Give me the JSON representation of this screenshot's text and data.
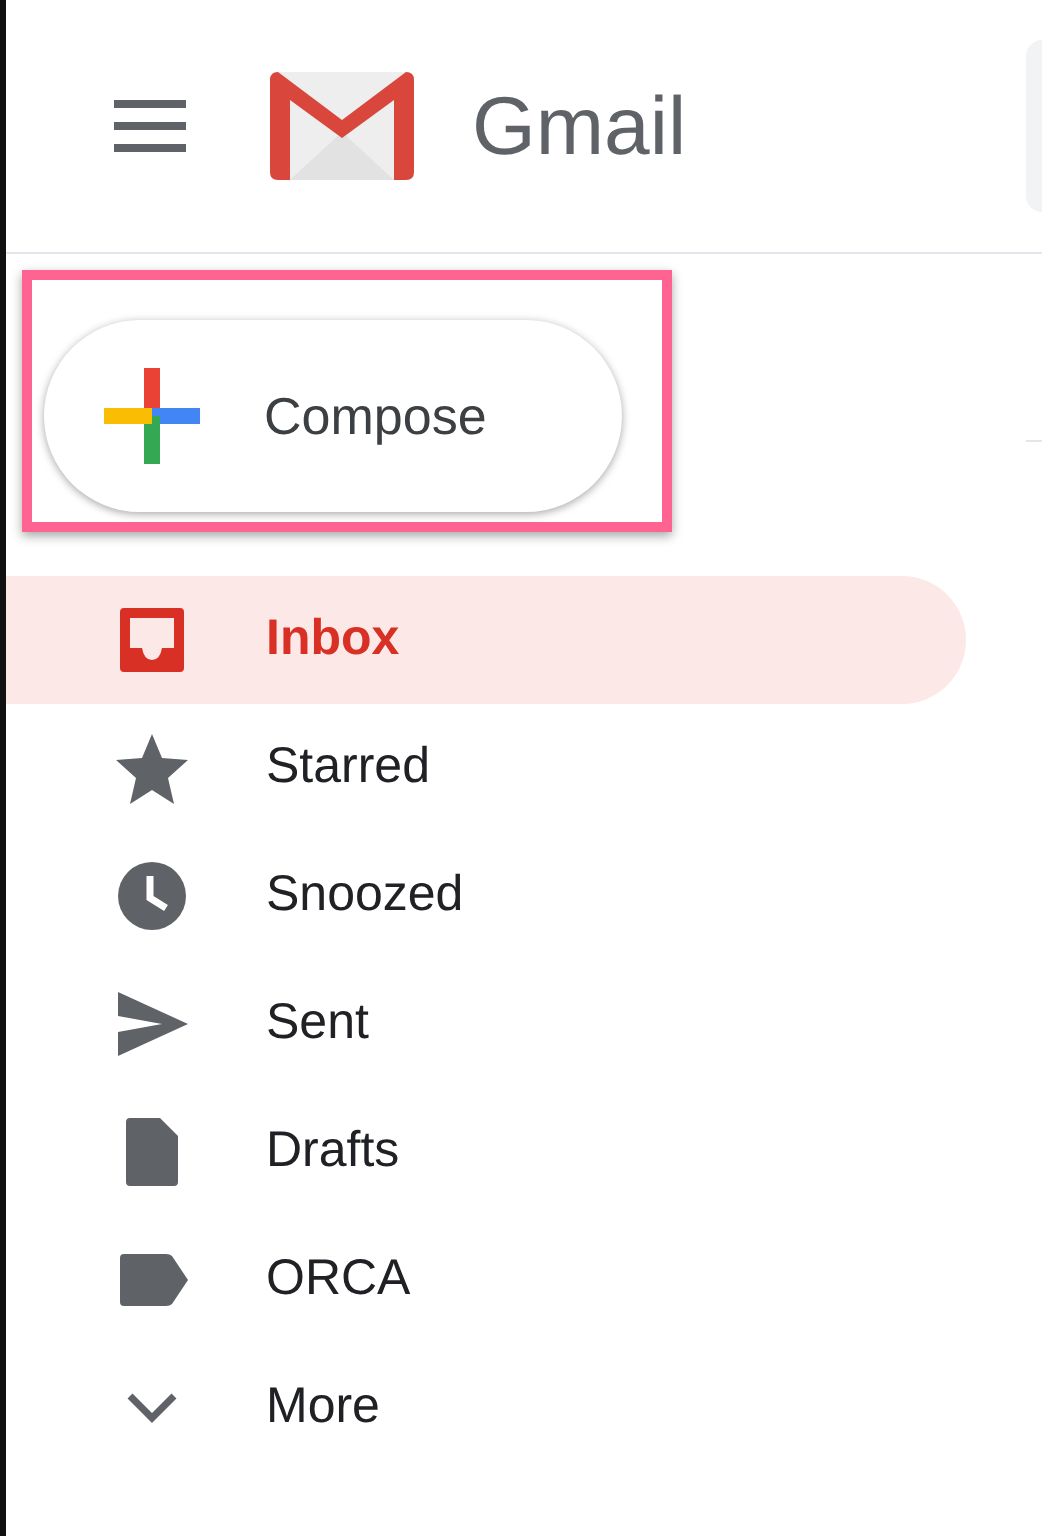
{
  "header": {
    "app_name": "Gmail"
  },
  "compose": {
    "label": "Compose",
    "highlighted": true
  },
  "nav": [
    {
      "label": "Inbox",
      "selected": true
    },
    {
      "label": "Starred",
      "selected": false
    },
    {
      "label": "Snoozed",
      "selected": false
    },
    {
      "label": "Sent",
      "selected": false
    },
    {
      "label": "Drafts",
      "selected": false
    },
    {
      "label": "ORCA",
      "selected": false
    },
    {
      "label": "More",
      "selected": false
    }
  ]
}
